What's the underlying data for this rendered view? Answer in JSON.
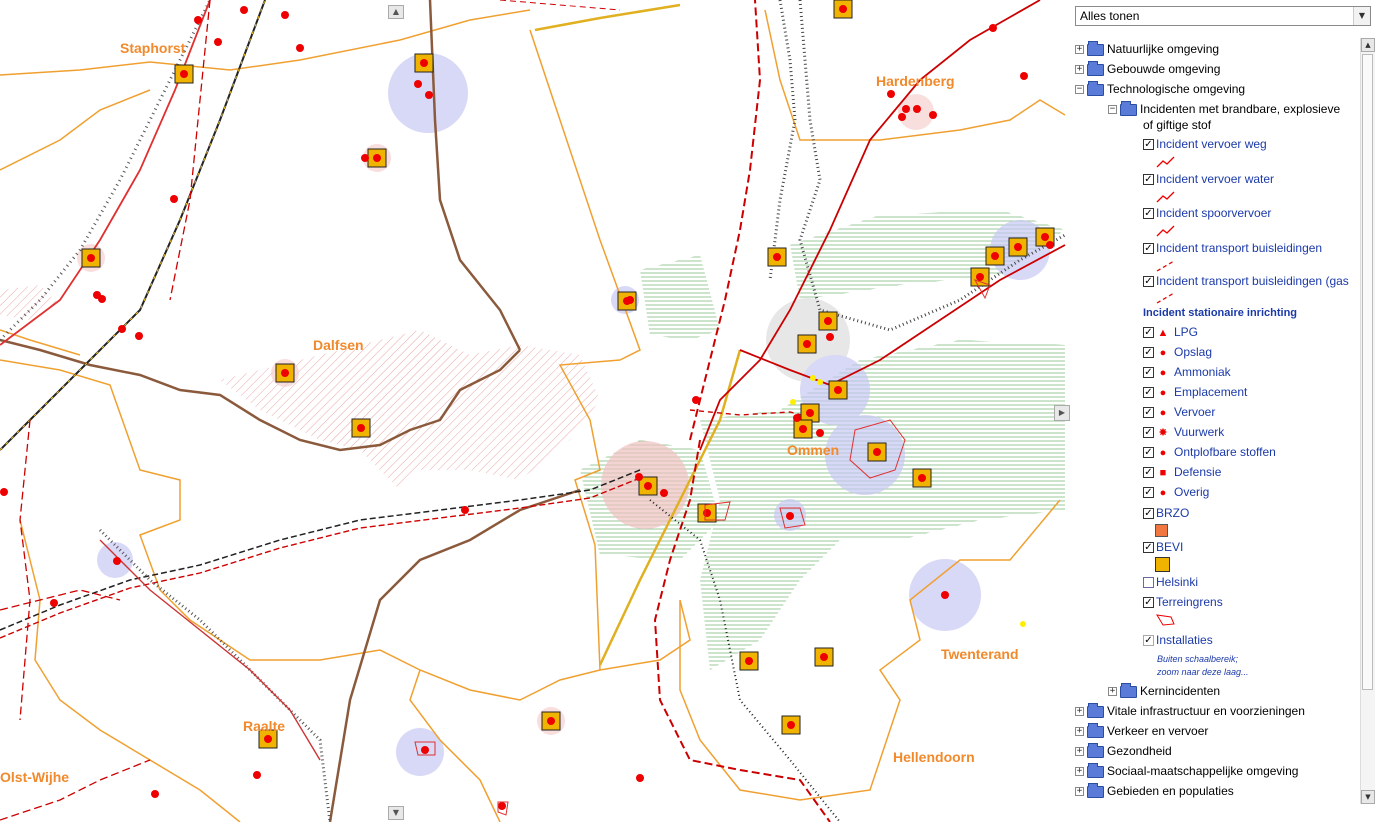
{
  "map": {
    "places": [
      {
        "name": "Staphorst"
      },
      {
        "name": "Hardenberg"
      },
      {
        "name": "Dalfsen"
      },
      {
        "name": "Ommen"
      },
      {
        "name": "Twenterand"
      },
      {
        "name": "Raalte"
      },
      {
        "name": "Olst-Wijhe"
      },
      {
        "name": "Hellendoorn"
      }
    ],
    "scroll_up_icon": "triangle-up",
    "scroll_down_icon": "triangle-down",
    "pan_right_icon": "triangle-right",
    "colors": {
      "incident": "#ff0000",
      "bevi": "#f0b400",
      "radius": "#b8b8f0",
      "municipality": "#f0a030",
      "river": "#8b5a3c"
    }
  },
  "panel": {
    "filter_value": "Alles tonen",
    "tree": {
      "natuurlijke": "Natuurlijke omgeving",
      "gebouwde": "Gebouwde omgeving",
      "technologische": "Technologische omgeving",
      "incidenten_line1": "Incidenten met brandbare, explosieve",
      "incidenten_line2": "of giftige stof",
      "vervoer_weg": "Incident vervoer weg",
      "vervoer_water": "Incident vervoer water",
      "spoorvervoer": "Incident spoorvervoer",
      "buisleidingen": "Incident transport buisleidingen",
      "buisleidingen_gas": "Incident transport buisleidingen (gas",
      "stationaire": "Incident stationaire inrichting",
      "lpg": "LPG",
      "opslag": "Opslag",
      "ammoniak": "Ammoniak",
      "emplacement": "Emplacement",
      "vervoer": "Vervoer",
      "vuurwerk": "Vuurwerk",
      "ontplofbare": "Ontplofbare stoffen",
      "defensie": "Defensie",
      "overig": "Overig",
      "brzo": "BRZO",
      "bevi": "BEVI",
      "helsinki": "Helsinki",
      "terreingrens": "Terreingrens",
      "installaties": "Installaties",
      "note_line1": "Buiten schaalbereik;",
      "note_line2": "zoom naar deze laag...",
      "kernincidenten": "Kernincidenten",
      "vitale": "Vitale infrastructuur en voorzieningen",
      "verkeer": "Verkeer en vervoer",
      "gezondheid": "Gezondheid",
      "sociaal": "Sociaal-maatschappelijke omgeving",
      "gebieden": "Gebieden en populaties"
    },
    "check_mark": "✓",
    "expand_symbol": "+",
    "collapse_symbol": "−"
  }
}
